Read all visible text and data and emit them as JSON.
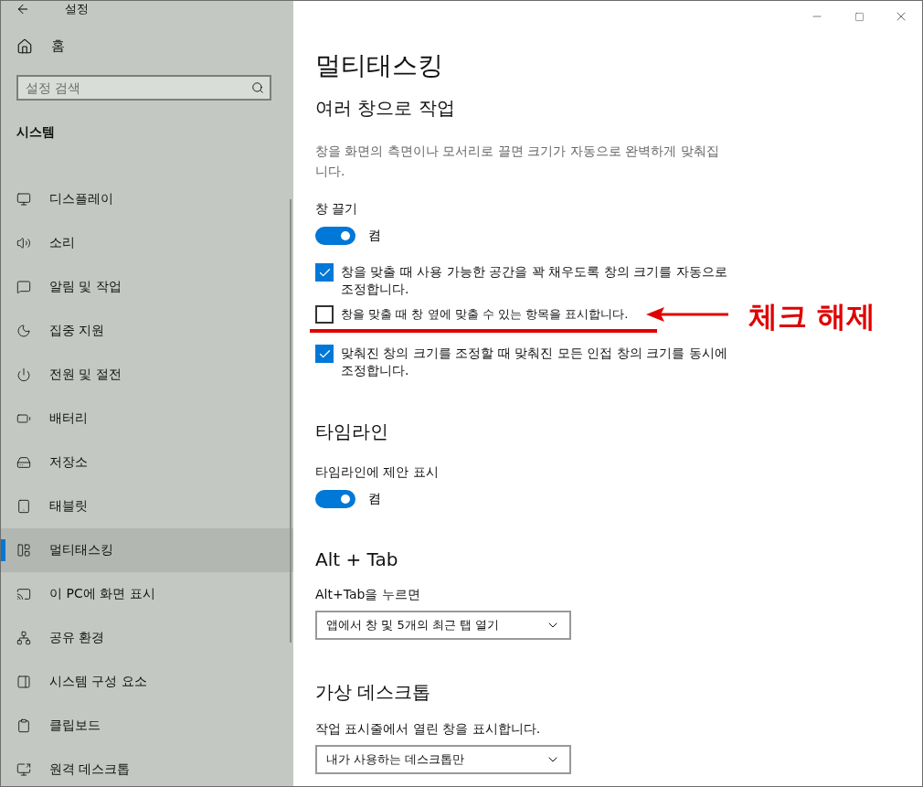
{
  "window": {
    "title": "설정"
  },
  "sidebar": {
    "home": "홈",
    "search": {
      "placeholder": "설정 검색"
    },
    "section": "시스템",
    "items": [
      {
        "label": "디스플레이",
        "kind": "display",
        "selected": false
      },
      {
        "label": "소리",
        "kind": "sound",
        "selected": false
      },
      {
        "label": "알림 및 작업",
        "kind": "notifications",
        "selected": false
      },
      {
        "label": "집중 지원",
        "kind": "focus",
        "selected": false
      },
      {
        "label": "전원 및 절전",
        "kind": "power",
        "selected": false
      },
      {
        "label": "배터리",
        "kind": "battery",
        "selected": false
      },
      {
        "label": "저장소",
        "kind": "storage",
        "selected": false
      },
      {
        "label": "태블릿",
        "kind": "tablet",
        "selected": false
      },
      {
        "label": "멀티태스킹",
        "kind": "multitasking",
        "selected": true
      },
      {
        "label": "이 PC에 화면 표시",
        "kind": "projecting",
        "selected": false
      },
      {
        "label": "공유 환경",
        "kind": "shared",
        "selected": false
      },
      {
        "label": "시스템 구성 요소",
        "kind": "components",
        "selected": false
      },
      {
        "label": "클립보드",
        "kind": "clipboard",
        "selected": false
      },
      {
        "label": "원격 데스크톱",
        "kind": "remote",
        "selected": false
      }
    ]
  },
  "page": {
    "title": "멀티태스킹",
    "sections": [
      {
        "heading": "여러 창으로 작업",
        "description": "창을 화면의 측면이나 모서리로 끌면 크기가 자동으로 완벽하게 맞춰집니다.",
        "controls": [
          {
            "kind": "toggle",
            "label": "창 끌기",
            "on": true,
            "state": "켬"
          },
          {
            "kind": "checkbox",
            "label": "창을 맞출 때 사용 가능한 공간을 꽉 채우도록 창의 크기를 자동으로 조정합니다.",
            "checked": true
          },
          {
            "kind": "checkbox",
            "label": "창을 맞출 때 창 옆에 맞출 수 있는 항목을 표시합니다.",
            "checked": false,
            "annotation": "체크 해제"
          },
          {
            "kind": "checkbox",
            "label": "맞춰진 창의 크기를 조정할 때 맞춰진 모든 인접 창의 크기를 동시에 조정합니다.",
            "checked": true
          }
        ]
      },
      {
        "heading": "타임라인",
        "controls": [
          {
            "kind": "toggle",
            "label": "타임라인에 제안 표시",
            "on": true,
            "state": "켬"
          }
        ]
      },
      {
        "heading": "Alt + Tab",
        "controls": [
          {
            "kind": "dropdown",
            "label": "Alt+Tab을 누르면",
            "value": "앱에서 창 및 5개의 최근 탭 열기"
          }
        ]
      },
      {
        "heading": "가상 데스크톱",
        "controls": [
          {
            "kind": "dropdown",
            "label": "작업 표시줄에서 열린 창을 표시합니다.",
            "value": "내가 사용하는 데스크톱만"
          }
        ]
      }
    ]
  }
}
